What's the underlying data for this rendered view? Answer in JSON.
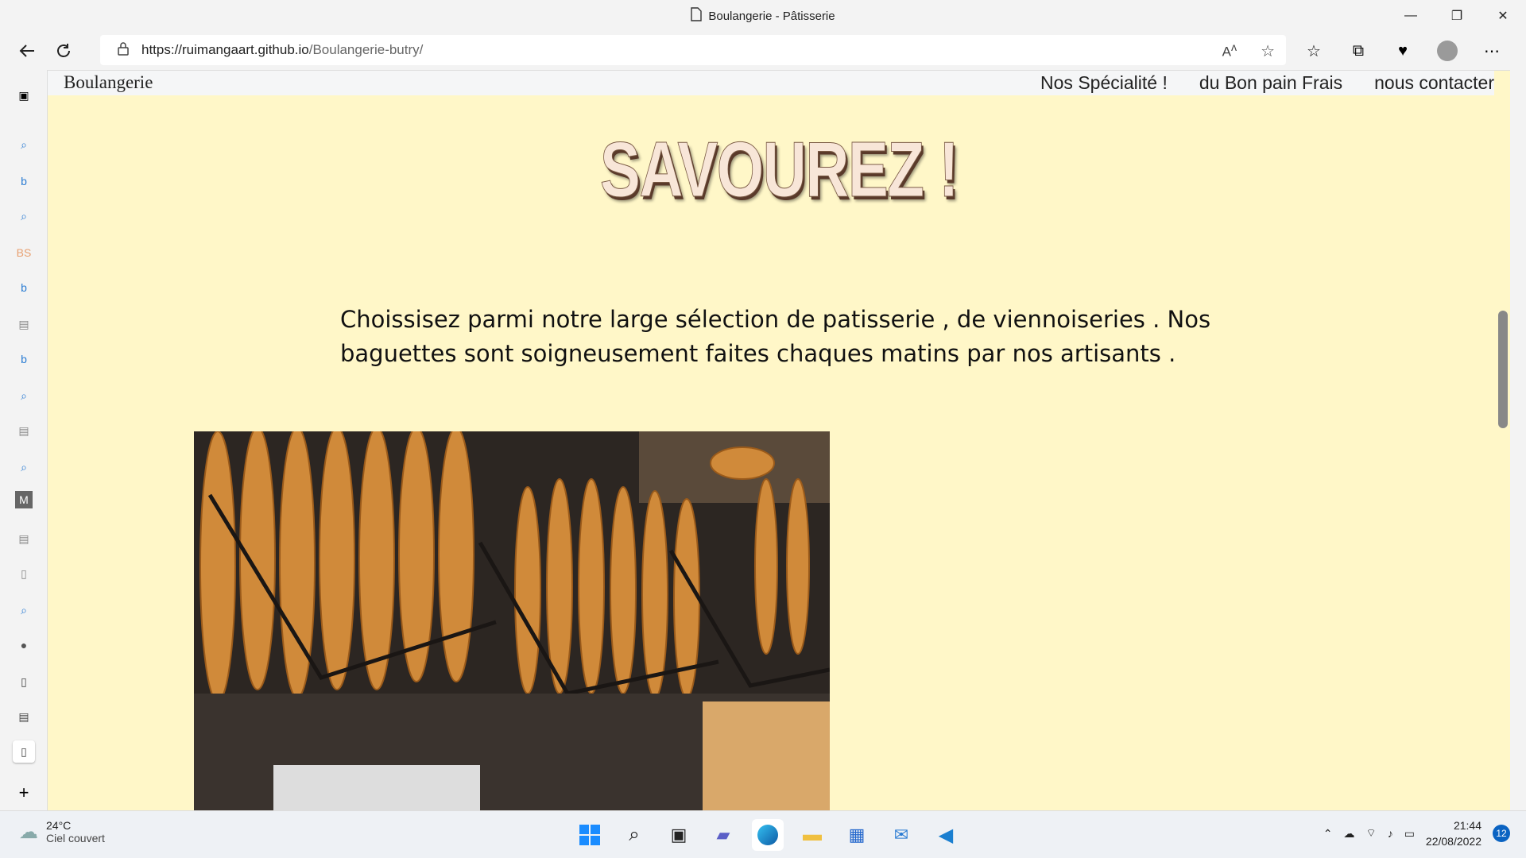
{
  "window": {
    "title": "Boulangerie - Pâtisserie",
    "minimize": "—",
    "restore": "❐",
    "close": "✕"
  },
  "browser": {
    "url_host": "https://ruimangaart.github.io",
    "url_path": "/Boulangerie-butry/"
  },
  "page": {
    "brand": "Boulangerie",
    "nav_links": [
      "Nos Spécialité !",
      "du Bon pain Frais",
      "nous contacter"
    ],
    "hero": "SAVOUREZ !",
    "paragraph": "Choissisez parmi notre large sélection de patisserie , de viennoiseries . Nos baguettes sont soigneusement faites chaques matins par nos artisants ."
  },
  "taskbar": {
    "temperature": "24°C",
    "weather": "Ciel couvert",
    "time": "21:44",
    "date": "22/08/2022",
    "notifications": "12"
  },
  "colors": {
    "page_bg": "#fff7c8",
    "hero_text": "#f8e6d8",
    "accent": "#0a63c2"
  }
}
